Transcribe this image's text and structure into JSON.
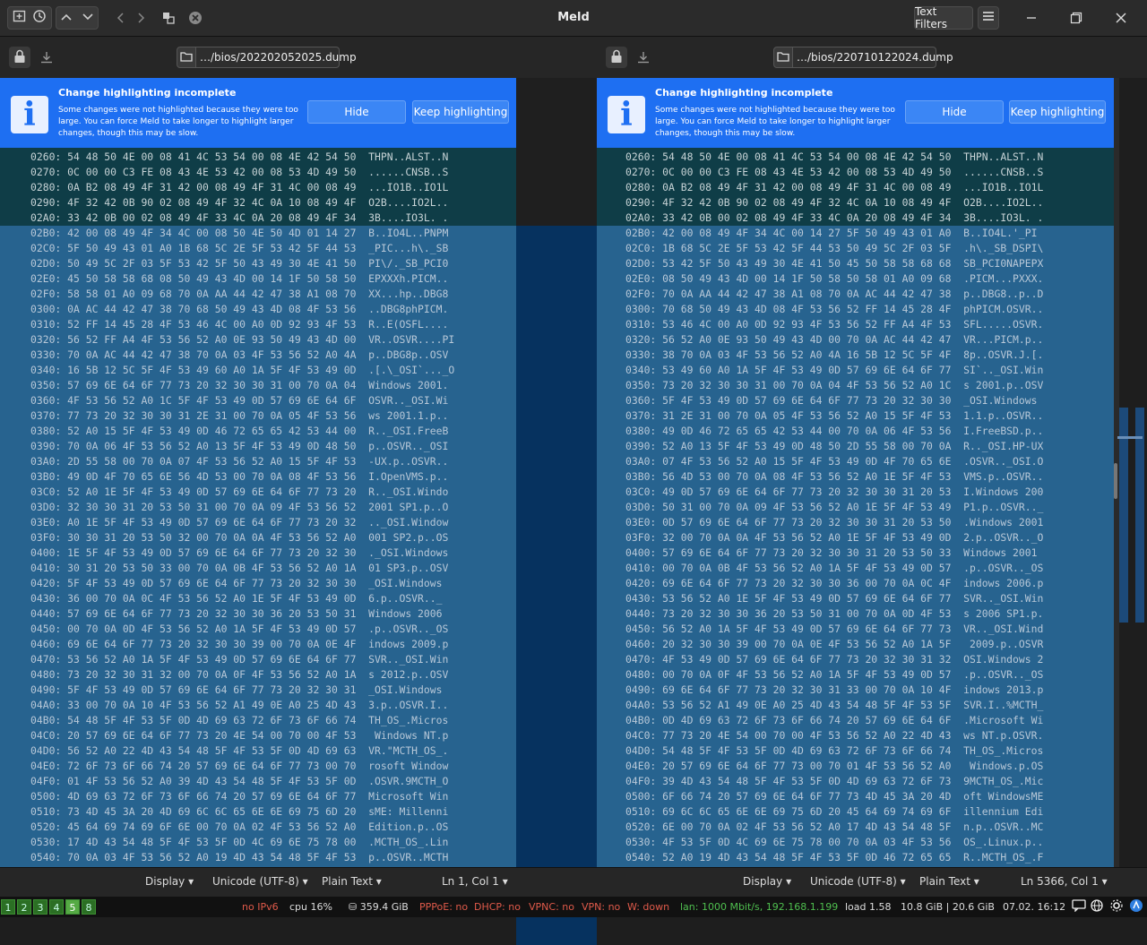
{
  "window": {
    "title": "Meld",
    "text_filters": "Text Filters"
  },
  "left": {
    "path": "…/bios/202202052025.dump",
    "info": {
      "title": "Change highlighting incomplete",
      "message": "Some changes were not highlighted because they were too large. You can force Meld to take longer to highlight larger changes, though this may be slow.",
      "hide": "Hide",
      "keep": "Keep highlighting"
    },
    "lines": [
      "0260: 54 48 50 4E 00 08 41 4C 53 54 00 08 4E 42 54 50  THPN..ALST..N",
      "0270: 0C 00 00 C3 FE 08 43 4E 53 42 00 08 53 4D 49 50  ......CNSB..S",
      "0280: 0A B2 08 49 4F 31 42 00 08 49 4F 31 4C 00 08 49  ...IO1B..IO1L",
      "0290: 4F 32 42 0B 90 02 08 49 4F 32 4C 0A 10 08 49 4F  O2B....IO2L..",
      "02A0: 33 42 0B 00 02 08 49 4F 33 4C 0A 20 08 49 4F 34  3B....IO3L. .",
      "02B0: 42 00 08 49 4F 34 4C 00 08 50 4E 50 4D 01 14 27  B..IO4L..PNPM",
      "02C0: 5F 50 49 43 01 A0 1B 68 5C 2E 5F 53 42 5F 44 53  _PIC...h\\._SB",
      "02D0: 50 49 5C 2F 03 5F 53 42 5F 50 43 49 30 4E 41 50  PI\\/._SB_PCI0",
      "02E0: 45 50 58 58 68 08 50 49 43 4D 00 14 1F 50 58 50  EPXXXh.PICM..",
      "02F0: 58 58 01 A0 09 68 70 0A AA 44 42 47 38 A1 08 70  XX...hp..DBG8",
      "0300: 0A AC 44 42 47 38 70 68 50 49 43 4D 08 4F 53 56  ..DBG8phPICM.",
      "0310: 52 FF 14 45 28 4F 53 46 4C 00 A0 0D 92 93 4F 53  R..E(OSFL....",
      "0320: 56 52 FF A4 4F 53 56 52 A0 0E 93 50 49 43 4D 00  VR..OSVR....PI",
      "0330: 70 0A AC 44 42 47 38 70 0A 03 4F 53 56 52 A0 4A  p..DBG8p..OSV",
      "0340: 16 5B 12 5C 5F 4F 53 49 60 A0 1A 5F 4F 53 49 0D  .[.\\_OSI`..._O",
      "0350: 57 69 6E 64 6F 77 73 20 32 30 30 31 00 70 0A 04  Windows 2001.",
      "0360: 4F 53 56 52 A0 1C 5F 4F 53 49 0D 57 69 6E 64 6F  OSVR.._OSI.Wi",
      "0370: 77 73 20 32 30 30 31 2E 31 00 70 0A 05 4F 53 56  ws 2001.1.p..",
      "0380: 52 A0 15 5F 4F 53 49 0D 46 72 65 65 42 53 44 00  R.._OSI.FreeB",
      "0390: 70 0A 06 4F 53 56 52 A0 13 5F 4F 53 49 0D 48 50  p..OSVR.._OSI",
      "03A0: 2D 55 58 00 70 0A 07 4F 53 56 52 A0 15 5F 4F 53  -UX.p..OSVR..",
      "03B0: 49 0D 4F 70 65 6E 56 4D 53 00 70 0A 08 4F 53 56  I.OpenVMS.p..",
      "03C0: 52 A0 1E 5F 4F 53 49 0D 57 69 6E 64 6F 77 73 20  R.._OSI.Windo",
      "03D0: 32 30 30 31 20 53 50 31 00 70 0A 09 4F 53 56 52  2001 SP1.p..O",
      "03E0: A0 1E 5F 4F 53 49 0D 57 69 6E 64 6F 77 73 20 32  .._OSI.Window",
      "03F0: 30 30 31 20 53 50 32 00 70 0A 0A 4F 53 56 52 A0  001 SP2.p..OS",
      "0400: 1E 5F 4F 53 49 0D 57 69 6E 64 6F 77 73 20 32 30  ._OSI.Windows",
      "0410: 30 31 20 53 50 33 00 70 0A 0B 4F 53 56 52 A0 1A  01 SP3.p..OSV",
      "0420: 5F 4F 53 49 0D 57 69 6E 64 6F 77 73 20 32 30 30  _OSI.Windows ",
      "0430: 36 00 70 0A 0C 4F 53 56 52 A0 1E 5F 4F 53 49 0D  6.p..OSVR.._",
      "0440: 57 69 6E 64 6F 77 73 20 32 30 30 36 20 53 50 31  Windows 2006 ",
      "0450: 00 70 0A 0D 4F 53 56 52 A0 1A 5F 4F 53 49 0D 57  .p..OSVR.._OS",
      "0460: 69 6E 64 6F 77 73 20 32 30 30 39 00 70 0A 0E 4F  indows 2009.p",
      "0470: 53 56 52 A0 1A 5F 4F 53 49 0D 57 69 6E 64 6F 77  SVR.._OSI.Win",
      "0480: 73 20 32 30 31 32 00 70 0A 0F 4F 53 56 52 A0 1A  s 2012.p..OSV",
      "0490: 5F 4F 53 49 0D 57 69 6E 64 6F 77 73 20 32 30 31  _OSI.Windows ",
      "04A0: 33 00 70 0A 10 4F 53 56 52 A1 49 0E A0 25 4D 43  3.p..OSVR.I..",
      "04B0: 54 48 5F 4F 53 5F 0D 4D 69 63 72 6F 73 6F 66 74  TH_OS_.Micros",
      "04C0: 20 57 69 6E 64 6F 77 73 20 4E 54 00 70 00 4F 53   Windows NT.p",
      "04D0: 56 52 A0 22 4D 43 54 48 5F 4F 53 5F 0D 4D 69 63  VR.\"MCTH_OS_.",
      "04E0: 72 6F 73 6F 66 74 20 57 69 6E 64 6F 77 73 00 70  rosoft Window",
      "04F0: 01 4F 53 56 52 A0 39 4D 43 54 48 5F 4F 53 5F 0D  .OSVR.9MCTH_O",
      "0500: 4D 69 63 72 6F 73 6F 66 74 20 57 69 6E 64 6F 77  Microsoft Win",
      "0510: 73 4D 45 3A 20 4D 69 6C 6C 65 6E 6E 69 75 6D 20  sME: Millenni",
      "0520: 45 64 69 74 69 6F 6E 00 70 0A 02 4F 53 56 52 A0  Edition.p..OS",
      "0530: 17 4D 43 54 48 5F 4F 53 5F 0D 4C 69 6E 75 78 00  .MCTH_OS_.Lin",
      "0540: 70 0A 03 4F 53 56 52 A0 19 4D 43 54 48 5F 4F 53  p..OSVR..MCTH"
    ],
    "status": {
      "display": "Display",
      "encoding": "Unicode (UTF-8)",
      "syntax": "Plain Text",
      "position": "Ln 1, Col 1"
    }
  },
  "right": {
    "path": "…/bios/220710122024.dump",
    "info": {
      "title": "Change highlighting incomplete",
      "message": "Some changes were not highlighted because they were too large. You can force Meld to take longer to highlight larger changes, though this may be slow.",
      "hide": "Hide",
      "keep": "Keep highlighting"
    },
    "lines": [
      "0260: 54 48 50 4E 00 08 41 4C 53 54 00 08 4E 42 54 50  THPN..ALST..N",
      "0270: 0C 00 00 C3 FE 08 43 4E 53 42 00 08 53 4D 49 50  ......CNSB..S",
      "0280: 0A B2 08 49 4F 31 42 00 08 49 4F 31 4C 00 08 49  ...IO1B..IO1L",
      "0290: 4F 32 42 0B 90 02 08 49 4F 32 4C 0A 10 08 49 4F  O2B....IO2L..",
      "02A0: 33 42 0B 00 02 08 49 4F 33 4C 0A 20 08 49 4F 34  3B....IO3L. .",
      "02B0: 42 00 08 49 4F 34 4C 00 14 27 5F 50 49 43 01 A0  B..IO4L.'_PI",
      "02C0: 1B 68 5C 2E 5F 53 42 5F 44 53 50 49 5C 2F 03 5F  .h\\._SB_DSPI\\",
      "02D0: 53 42 5F 50 43 49 30 4E 41 50 45 50 58 58 68 68  SB_PCI0NAPEPX",
      "02E0: 08 50 49 43 4D 00 14 1F 50 58 50 58 01 A0 09 68  .PICM...PXXX.",
      "02F0: 70 0A AA 44 42 47 38 A1 08 70 0A AC 44 42 47 38  p..DBG8..p..D",
      "0300: 70 68 50 49 43 4D 08 4F 53 56 52 FF 14 45 28 4F  phPICM.OSVR..",
      "0310: 53 46 4C 00 A0 0D 92 93 4F 53 56 52 FF A4 4F 53  SFL.....OSVR.",
      "0320: 56 52 A0 0E 93 50 49 43 4D 00 70 0A AC 44 42 47  VR...PICM.p..",
      "0330: 38 70 0A 03 4F 53 56 52 A0 4A 16 5B 12 5C 5F 4F  8p..OSVR.J.[.",
      "0340: 53 49 60 A0 1A 5F 4F 53 49 0D 57 69 6E 64 6F 77  SI`.._OSI.Win",
      "0350: 73 20 32 30 30 31 00 70 0A 04 4F 53 56 52 A0 1C  s 2001.p..OSV",
      "0360: 5F 4F 53 49 0D 57 69 6E 64 6F 77 73 20 32 30 30  _OSI.Windows ",
      "0370: 31 2E 31 00 70 0A 05 4F 53 56 52 A0 15 5F 4F 53  1.1.p..OSVR..",
      "0380: 49 0D 46 72 65 65 42 53 44 00 70 0A 06 4F 53 56  I.FreeBSD.p..",
      "0390: 52 A0 13 5F 4F 53 49 0D 48 50 2D 55 58 00 70 0A  R.._OSI.HP-UX",
      "03A0: 07 4F 53 56 52 A0 15 5F 4F 53 49 0D 4F 70 65 6E  .OSVR.._OSI.O",
      "03B0: 56 4D 53 00 70 0A 08 4F 53 56 52 A0 1E 5F 4F 53  VMS.p..OSVR..",
      "03C0: 49 0D 57 69 6E 64 6F 77 73 20 32 30 30 31 20 53  I.Windows 200",
      "03D0: 50 31 00 70 0A 09 4F 53 56 52 A0 1E 5F 4F 53 49  P1.p..OSVR.._",
      "03E0: 0D 57 69 6E 64 6F 77 73 20 32 30 30 31 20 53 50  .Windows 2001",
      "03F0: 32 00 70 0A 0A 4F 53 56 52 A0 1E 5F 4F 53 49 0D  2.p..OSVR.._O",
      "0400: 57 69 6E 64 6F 77 73 20 32 30 30 31 20 53 50 33  Windows 2001 ",
      "0410: 00 70 0A 0B 4F 53 56 52 A0 1A 5F 4F 53 49 0D 57  .p..OSVR.._OS",
      "0420: 69 6E 64 6F 77 73 20 32 30 30 36 00 70 0A 0C 4F  indows 2006.p",
      "0430: 53 56 52 A0 1E 5F 4F 53 49 0D 57 69 6E 64 6F 77  SVR.._OSI.Win",
      "0440: 73 20 32 30 30 36 20 53 50 31 00 70 0A 0D 4F 53  s 2006 SP1.p.",
      "0450: 56 52 A0 1A 5F 4F 53 49 0D 57 69 6E 64 6F 77 73  VR.._OSI.Wind",
      "0460: 20 32 30 30 39 00 70 0A 0E 4F 53 56 52 A0 1A 5F   2009.p..OSVR",
      "0470: 4F 53 49 0D 57 69 6E 64 6F 77 73 20 32 30 31 32  OSI.Windows 2",
      "0480: 00 70 0A 0F 4F 53 56 52 A0 1A 5F 4F 53 49 0D 57  .p..OSVR.._OS",
      "0490: 69 6E 64 6F 77 73 20 32 30 31 33 00 70 0A 10 4F  indows 2013.p",
      "04A0: 53 56 52 A1 49 0E A0 25 4D 43 54 48 5F 4F 53 5F  SVR.I..%MCTH_",
      "04B0: 0D 4D 69 63 72 6F 73 6F 66 74 20 57 69 6E 64 6F  .Microsoft Wi",
      "04C0: 77 73 20 4E 54 00 70 00 4F 53 56 52 A0 22 4D 43  ws NT.p.OSVR.",
      "04D0: 54 48 5F 4F 53 5F 0D 4D 69 63 72 6F 73 6F 66 74  TH_OS_.Micros",
      "04E0: 20 57 69 6E 64 6F 77 73 00 70 01 4F 53 56 52 A0   Windows.p.OS",
      "04F0: 39 4D 43 54 48 5F 4F 53 5F 0D 4D 69 63 72 6F 73  9MCTH_OS_.Mic",
      "0500: 6F 66 74 20 57 69 6E 64 6F 77 73 4D 45 3A 20 4D  oft WindowsME",
      "0510: 69 6C 6C 65 6E 6E 69 75 6D 20 45 64 69 74 69 6F  illennium Edi",
      "0520: 6E 00 70 0A 02 4F 53 56 52 A0 17 4D 43 54 48 5F  n.p..OSVR..MC",
      "0530: 4F 53 5F 0D 4C 69 6E 75 78 00 70 0A 03 4F 53 56  OS_.Linux.p..",
      "0540: 52 A0 19 4D 43 54 48 5F 4F 53 5F 0D 46 72 65 65  R..MCTH_OS_.F"
    ],
    "status": {
      "display": "Display",
      "encoding": "Unicode (UTF-8)",
      "syntax": "Plain Text",
      "position": "Ln 5366, Col 1"
    }
  },
  "panel": {
    "workspaces": [
      "1",
      "2",
      "3",
      "4",
      "5",
      "8"
    ],
    "ipv6": "no IPv6",
    "cpu": "cpu  16%",
    "disk": "359.4 GiB",
    "pppoe": "PPPoE: no",
    "dhcp": "DHCP: no",
    "vpnc": "VPNC: no",
    "vpn": "VPN: no",
    "wlan": "W: down",
    "lan": "lan: 1000 Mbit/s, 192.168.1.199",
    "load": "load 1.58",
    "mem": "10.8 GiB | 20.6 GiB",
    "clock": "07.02. 16:12"
  },
  "colors": {
    "infobar": "#1e6ff2",
    "changed": "#27638f",
    "equal": "#0f3d47",
    "ok": "#4fbf4f",
    "bad": "#e05a4a"
  }
}
